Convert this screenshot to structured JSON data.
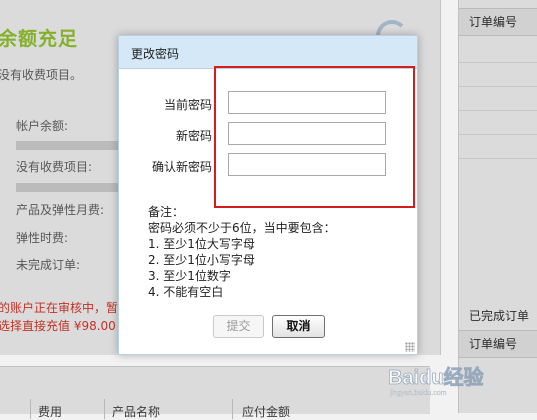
{
  "background": {
    "balance_title": "余额充足",
    "no_charge_text": "没有收费项目。",
    "fields": [
      "帐户余额:",
      "没有收费项目:",
      "产品及弹性月费:",
      "弹性时费:",
      "未完成订单:"
    ],
    "warn_line_1": "的账户正在审核中，暂",
    "warn_line_2": "选择直接充值 ¥98.00 以",
    "bottom_headers": [
      "费用",
      "产品名称",
      "应付金额"
    ],
    "right_panel": {
      "orders_header": "订单编号",
      "completed_title": "已完成订单",
      "completed_header": "订单编号"
    }
  },
  "dialog": {
    "title": "更改密码",
    "fields": [
      {
        "label": "当前密码",
        "value": ""
      },
      {
        "label": "新密码",
        "value": ""
      },
      {
        "label": "确认新密码",
        "value": ""
      }
    ],
    "notes": [
      "备注：",
      "密码必须不少于6位，当中要包含：",
      "1. 至少1位大写字母",
      "2. 至少1位小写字母",
      "3. 至少1位数字",
      "4. 不能有空白"
    ],
    "submit_label": "提交",
    "cancel_label": "取消"
  },
  "annotation": {
    "color": "#d41e1e"
  },
  "watermark": {
    "text": "Baidu经验",
    "small": "jingyan.baidu.com"
  }
}
